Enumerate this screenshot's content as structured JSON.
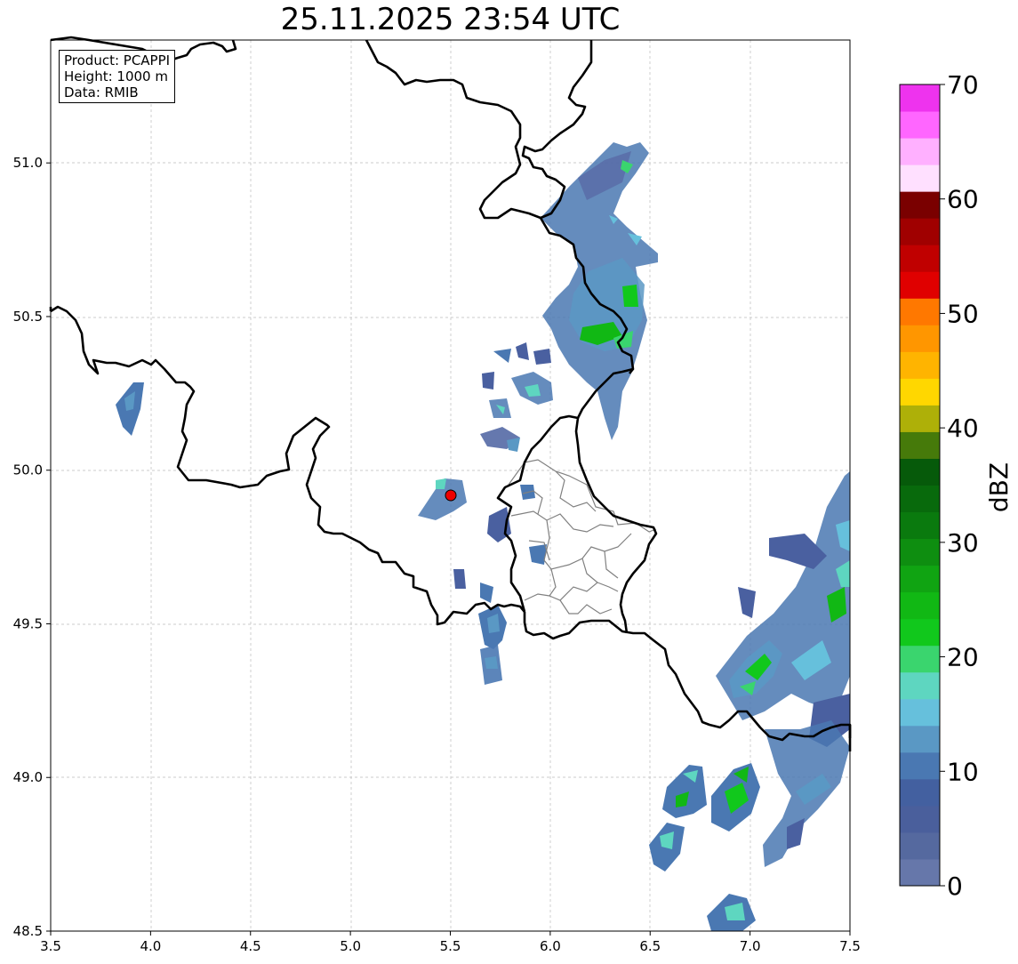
{
  "title": "25.11.2025 23:54 UTC",
  "info": {
    "product": "Product: PCAPPI",
    "height": "Height: 1000 m",
    "data": "Data: RMIB"
  },
  "axes": {
    "x_ticks": [
      "3.5",
      "4.0",
      "4.5",
      "5.0",
      "5.5",
      "6.0",
      "6.5",
      "7.0",
      "7.5"
    ],
    "y_ticks": [
      "48.5",
      "49.0",
      "49.5",
      "50.0",
      "50.5",
      "51.0"
    ],
    "x_range": [
      3.5,
      7.5
    ],
    "y_range": [
      48.5,
      51.4
    ],
    "grid": true
  },
  "radar_site": {
    "lon": 5.505,
    "lat": 49.915,
    "color": "#ee0000"
  },
  "colorbar": {
    "label": "dBZ",
    "ticks": [
      "0",
      "10",
      "20",
      "30",
      "40",
      "50",
      "60",
      "70"
    ],
    "range": [
      0,
      70
    ],
    "colors": [
      "#6677aa",
      "#55699f",
      "#4a5f9c",
      "#4360a0",
      "#4a78b2",
      "#5a98c4",
      "#66c0dc",
      "#5ed6c0",
      "#3ad56e",
      "#11c81c",
      "#11b814",
      "#10a412",
      "#0e8e10",
      "#0a7a0e",
      "#086a0c",
      "#065a0a",
      "#467a0a",
      "#aeb008",
      "#ffd700",
      "#ffb400",
      "#ff9600",
      "#ff7800",
      "#e00000",
      "#c00000",
      "#a00000",
      "#7a0000",
      "#ffe0ff",
      "#ffb0ff",
      "#ff66ff",
      "#ee33ee"
    ]
  },
  "map_colors": {
    "border": "#000000",
    "region_border": "#808080",
    "grid": "#bbbbbb"
  }
}
